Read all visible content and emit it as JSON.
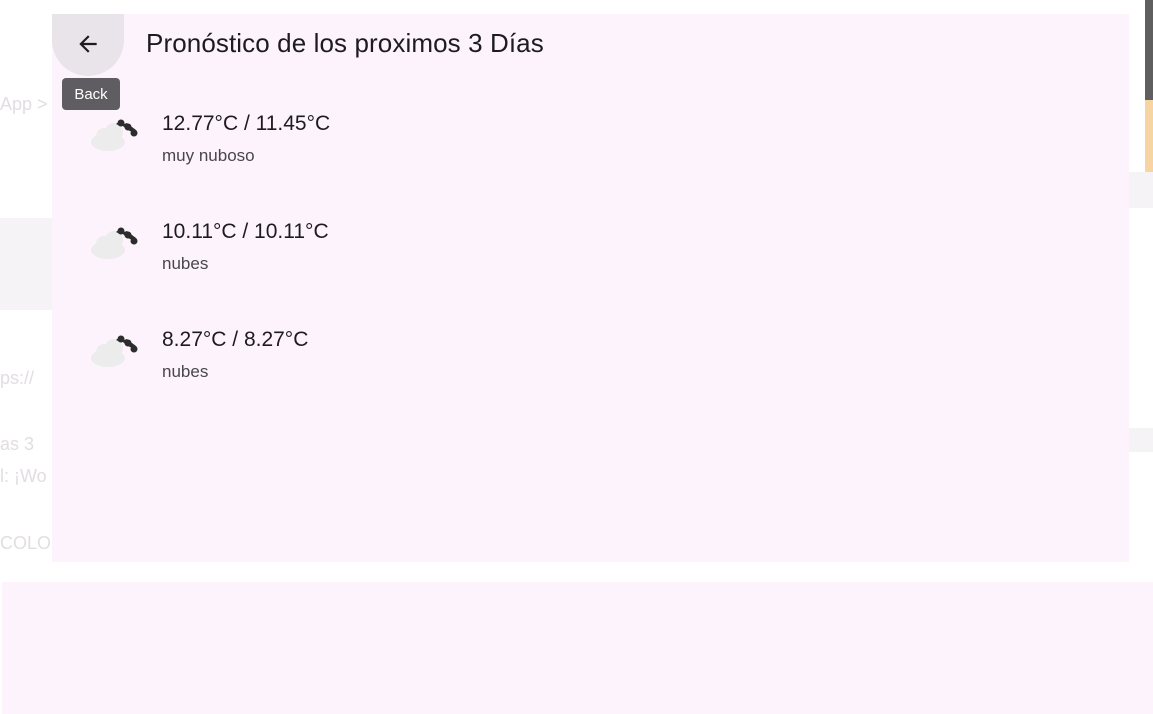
{
  "header": {
    "title": "Pronóstico de los proximos 3 Días",
    "back_tooltip": "Back"
  },
  "forecast": [
    {
      "temps": "12.77°C / 11.45°C",
      "description": "muy nuboso",
      "icon": "broken-clouds-icon"
    },
    {
      "temps": "10.11°C / 10.11°C",
      "description": "nubes",
      "icon": "broken-clouds-icon"
    },
    {
      "temps": "8.27°C / 8.27°C",
      "description": "nubes",
      "icon": "broken-clouds-icon"
    }
  ],
  "background": {
    "fragments": [
      "App >",
      "ps://",
      "as 3",
      "l: ¡Wo",
      "COLO"
    ]
  },
  "colors": {
    "surface": "#fdf3fd",
    "tooltip": "#605d62",
    "back_button": "#e9e4e9"
  }
}
